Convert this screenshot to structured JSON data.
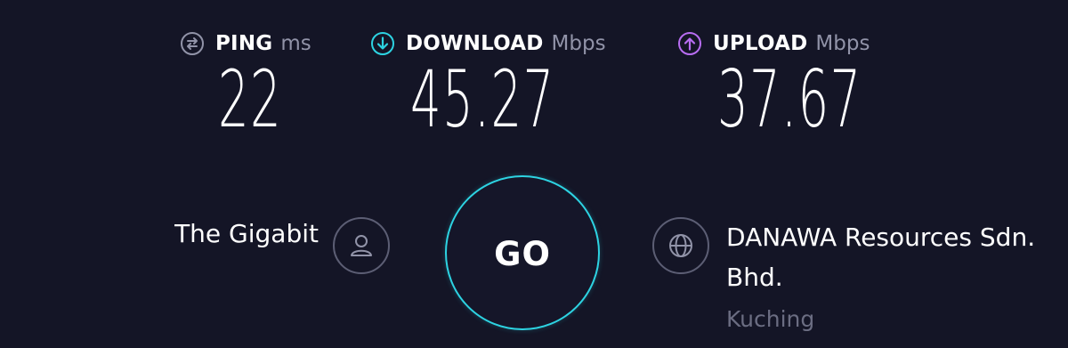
{
  "metrics": {
    "ping": {
      "label": "PING",
      "unit": "ms",
      "value": "22",
      "icon": "ping-icon",
      "color": "#9193a8"
    },
    "download": {
      "label": "DOWNLOAD",
      "unit": "Mbps",
      "value": "45.27",
      "icon": "download-arrow-icon",
      "color": "#2dd3e2"
    },
    "upload": {
      "label": "UPLOAD",
      "unit": "Mbps",
      "value": "37.67",
      "icon": "upload-arrow-icon",
      "color": "#b86df2"
    }
  },
  "provider": {
    "name": "The Gigabit",
    "icon": "user-icon"
  },
  "go_button": {
    "label": "GO",
    "accent": "#2dd3e2"
  },
  "server": {
    "name": "DANAWA Resources Sdn. Bhd.",
    "location": "Kuching",
    "icon": "globe-icon"
  },
  "theme": {
    "background": "#141526",
    "muted_text": "#9193a8"
  }
}
